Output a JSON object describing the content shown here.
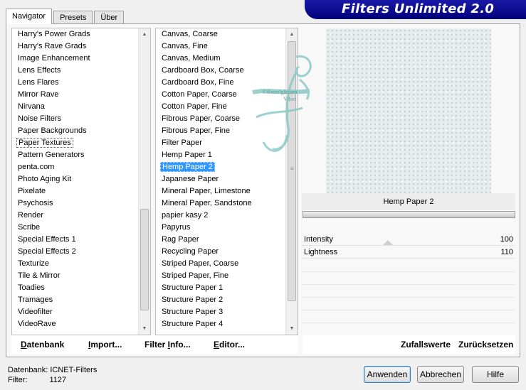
{
  "app": {
    "title": "Filters Unlimited 2.0"
  },
  "tabs": [
    "Navigator",
    "Presets",
    "Über"
  ],
  "categories": {
    "items": [
      "Harry's Power Grads",
      "Harry's Rave Grads",
      "Image Enhancement",
      "Lens Effects",
      "Lens Flares",
      "Mirror Rave",
      "Nirvana",
      "Noise Filters",
      "Paper Backgrounds",
      "Paper Textures",
      "Pattern Generators",
      "penta.com",
      "Photo Aging Kit",
      "Pixelate",
      "Psychosis",
      "Render",
      "Scribe",
      "Special Effects 1",
      "Special Effects 2",
      "Texturize",
      "Tile & Mirror",
      "Toadies",
      "Tramages",
      "Videofilter",
      "VideoRave"
    ],
    "focused_index": 9
  },
  "filters": {
    "items": [
      "Canvas, Coarse",
      "Canvas, Fine",
      "Canvas, Medium",
      "Cardboard Box, Coarse",
      "Cardboard Box, Fine",
      "Cotton Paper, Coarse",
      "Cotton Paper, Fine",
      "Fibrous Paper, Coarse",
      "Fibrous Paper, Fine",
      "Filter Paper",
      "Hemp Paper 1",
      "Hemp Paper 2",
      "Japanese Paper",
      "Mineral Paper, Limestone",
      "Mineral Paper, Sandstone",
      "papier kasy 2",
      "Papyrus",
      "Rag Paper",
      "Recycling Paper",
      "Striped Paper, Coarse",
      "Striped Paper, Fine",
      "Structure Paper 1",
      "Structure Paper 2",
      "Structure Paper 3",
      "Structure Paper 4"
    ],
    "selected_index": 11
  },
  "preview": {
    "filter_name": "Hemp Paper 2"
  },
  "params": [
    {
      "name": "Intensity",
      "value": "100"
    },
    {
      "name": "Lightness",
      "value": "110"
    }
  ],
  "toolbar": {
    "datenbank": {
      "ul": "D",
      "rest": "atenbank"
    },
    "import": {
      "ul": "I",
      "rest": "mport..."
    },
    "filterinfo": {
      "pre": "Filter ",
      "ul": "I",
      "rest": "nfo..."
    },
    "editor": {
      "ul": "E",
      "rest": "ditor..."
    },
    "zufall": "Zufallswerte",
    "zurueck": "Zurücksetzen"
  },
  "status": {
    "db_label": "Datenbank:",
    "db_value": "ICNET-Filters",
    "filter_label": "Filter:",
    "filter_value": "1127"
  },
  "buttons": {
    "apply": "Anwenden",
    "cancel": "Abbrechen",
    "help": "Hilfe"
  },
  "watermark_lines": [
    "©Bastelgleisen",
    "Viber"
  ]
}
